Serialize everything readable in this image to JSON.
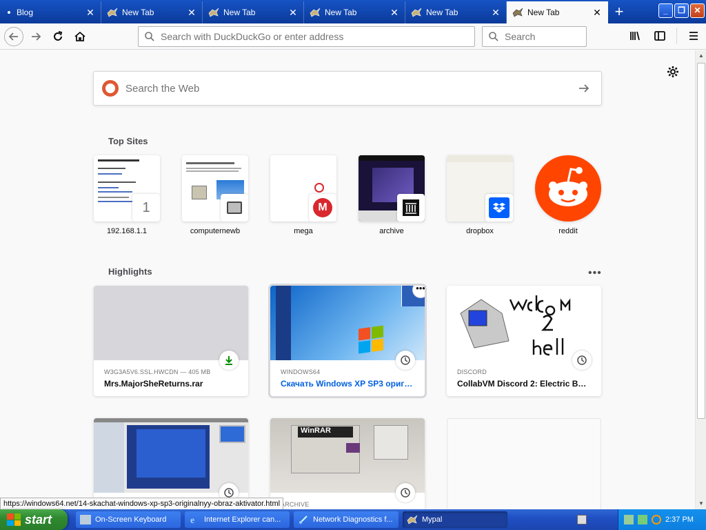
{
  "browser": {
    "tabs": [
      {
        "title": "Blog",
        "active": false
      },
      {
        "title": "New Tab",
        "active": false
      },
      {
        "title": "New Tab",
        "active": false
      },
      {
        "title": "New Tab",
        "active": false
      },
      {
        "title": "New Tab",
        "active": false
      },
      {
        "title": "New Tab",
        "active": true
      }
    ],
    "url_placeholder": "Search with DuckDuckGo or enter address",
    "search_placeholder": "Search"
  },
  "newtab": {
    "web_search_placeholder": "Search the Web",
    "top_sites_title": "Top Sites",
    "top_sites": [
      {
        "label": "192.168.1.1",
        "badge": "1"
      },
      {
        "label": "computernewb"
      },
      {
        "label": "mega",
        "badge": "M"
      },
      {
        "label": "archive"
      },
      {
        "label": "dropbox"
      },
      {
        "label": "reddit"
      }
    ],
    "highlights_title": "Highlights",
    "highlights": [
      {
        "source": "W3G3A5V6.SSL.HWCDN — 405 MB",
        "title": "Mrs.MajorSheReturns.rar"
      },
      {
        "source": "WINDOWS64",
        "title": "Скачать Windows XP SP3 ориги..."
      },
      {
        "source": "DISCORD",
        "title": "CollabVM Discord 2: Electric Boo..."
      },
      {
        "source": "",
        "title": ""
      },
      {
        "source": "ARCHIVE",
        "title": ""
      },
      {
        "source": "",
        "title": ""
      }
    ],
    "status_url": "https://windows64.net/14-skachat-windows-xp-sp3-originalnyy-obraz-aktivator.html"
  },
  "taskbar": {
    "start_label": "start",
    "tasks": [
      {
        "label": "On-Screen Keyboard",
        "active": false
      },
      {
        "label": "Internet Explorer can...",
        "active": false
      },
      {
        "label": "Network Diagnostics f...",
        "active": false
      },
      {
        "label": "Mypal",
        "active": true
      }
    ],
    "clock": "2:37 PM"
  },
  "colors": {
    "accent": "#0060df",
    "tabstrip": "#0c3da0",
    "taskbar": "#2050c4",
    "start": "#2f8a2f"
  }
}
